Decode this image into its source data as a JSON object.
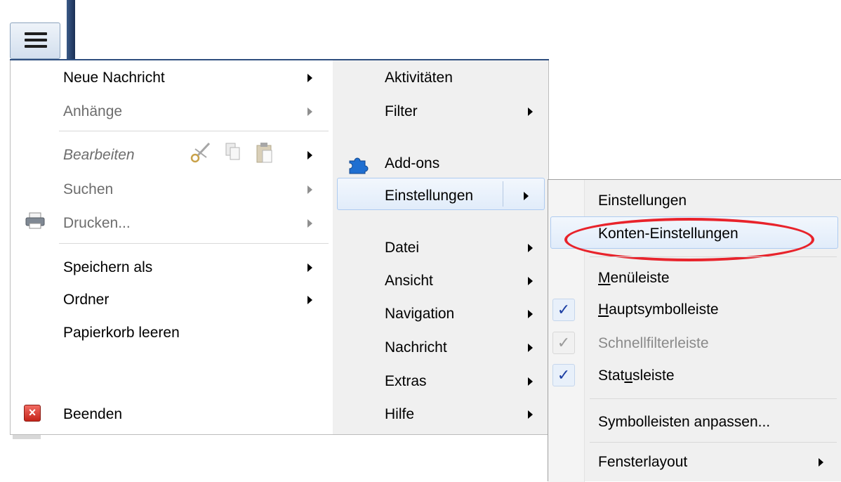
{
  "colors": {
    "accent_blue": "#1b3ea3",
    "highlight_border": "#aecbf0",
    "annotation_red": "#e8232b",
    "menu_bg": "#f0f0f0"
  },
  "app_button": {
    "icon": "hamburger-menu-icon"
  },
  "left_menu": {
    "items": [
      {
        "label": "Neue Nachricht",
        "enabled": true,
        "submenu": true
      },
      {
        "label": "Anhänge",
        "enabled": false,
        "submenu": true
      },
      {
        "label": "Bearbeiten",
        "enabled": false,
        "submenu": true,
        "icons": [
          "cut-icon",
          "copy-icon",
          "paste-icon"
        ]
      },
      {
        "label": "Suchen",
        "enabled": false,
        "submenu": true
      },
      {
        "label": "Drucken...",
        "enabled": false,
        "submenu": true,
        "icon": "printer-icon"
      },
      {
        "label": "Speichern als",
        "enabled": true,
        "submenu": true
      },
      {
        "label": "Ordner",
        "enabled": true,
        "submenu": true
      },
      {
        "label": "Papierkorb leeren",
        "enabled": true,
        "submenu": false
      },
      {
        "label": "Beenden",
        "enabled": true,
        "submenu": false,
        "icon": "exit-icon"
      }
    ]
  },
  "mid_menu": {
    "items": [
      {
        "label": "Aktivitäten",
        "submenu": false
      },
      {
        "label": "Filter",
        "submenu": true
      },
      {
        "label": "Add-ons",
        "submenu": false,
        "icon": "puzzle-icon"
      },
      {
        "label": "Einstellungen",
        "submenu": true,
        "highlighted": true
      },
      {
        "label": "Datei",
        "submenu": true
      },
      {
        "label": "Ansicht",
        "submenu": true
      },
      {
        "label": "Navigation",
        "submenu": true
      },
      {
        "label": "Nachricht",
        "submenu": true
      },
      {
        "label": "Extras",
        "submenu": true
      },
      {
        "label": "Hilfe",
        "submenu": true
      }
    ]
  },
  "sub_menu": {
    "items": [
      {
        "label": "Einstellungen"
      },
      {
        "label": "Konten-Einstellungen",
        "highlighted": true,
        "annotated": true
      },
      {
        "label_pre": "",
        "label_u": "M",
        "label_post": "enüleiste"
      },
      {
        "label_pre": "",
        "label_u": "H",
        "label_post": "auptsymbolleiste",
        "checked": true
      },
      {
        "label": "Schnellfilterleiste",
        "checked": true,
        "enabled": false
      },
      {
        "label_pre": "Stat",
        "label_u": "u",
        "label_post": "sleiste",
        "checked": true
      },
      {
        "label": "Symbolleisten anpassen..."
      },
      {
        "label": "Fensterlayout",
        "submenu": true
      }
    ],
    "check_glyph": "✓"
  }
}
